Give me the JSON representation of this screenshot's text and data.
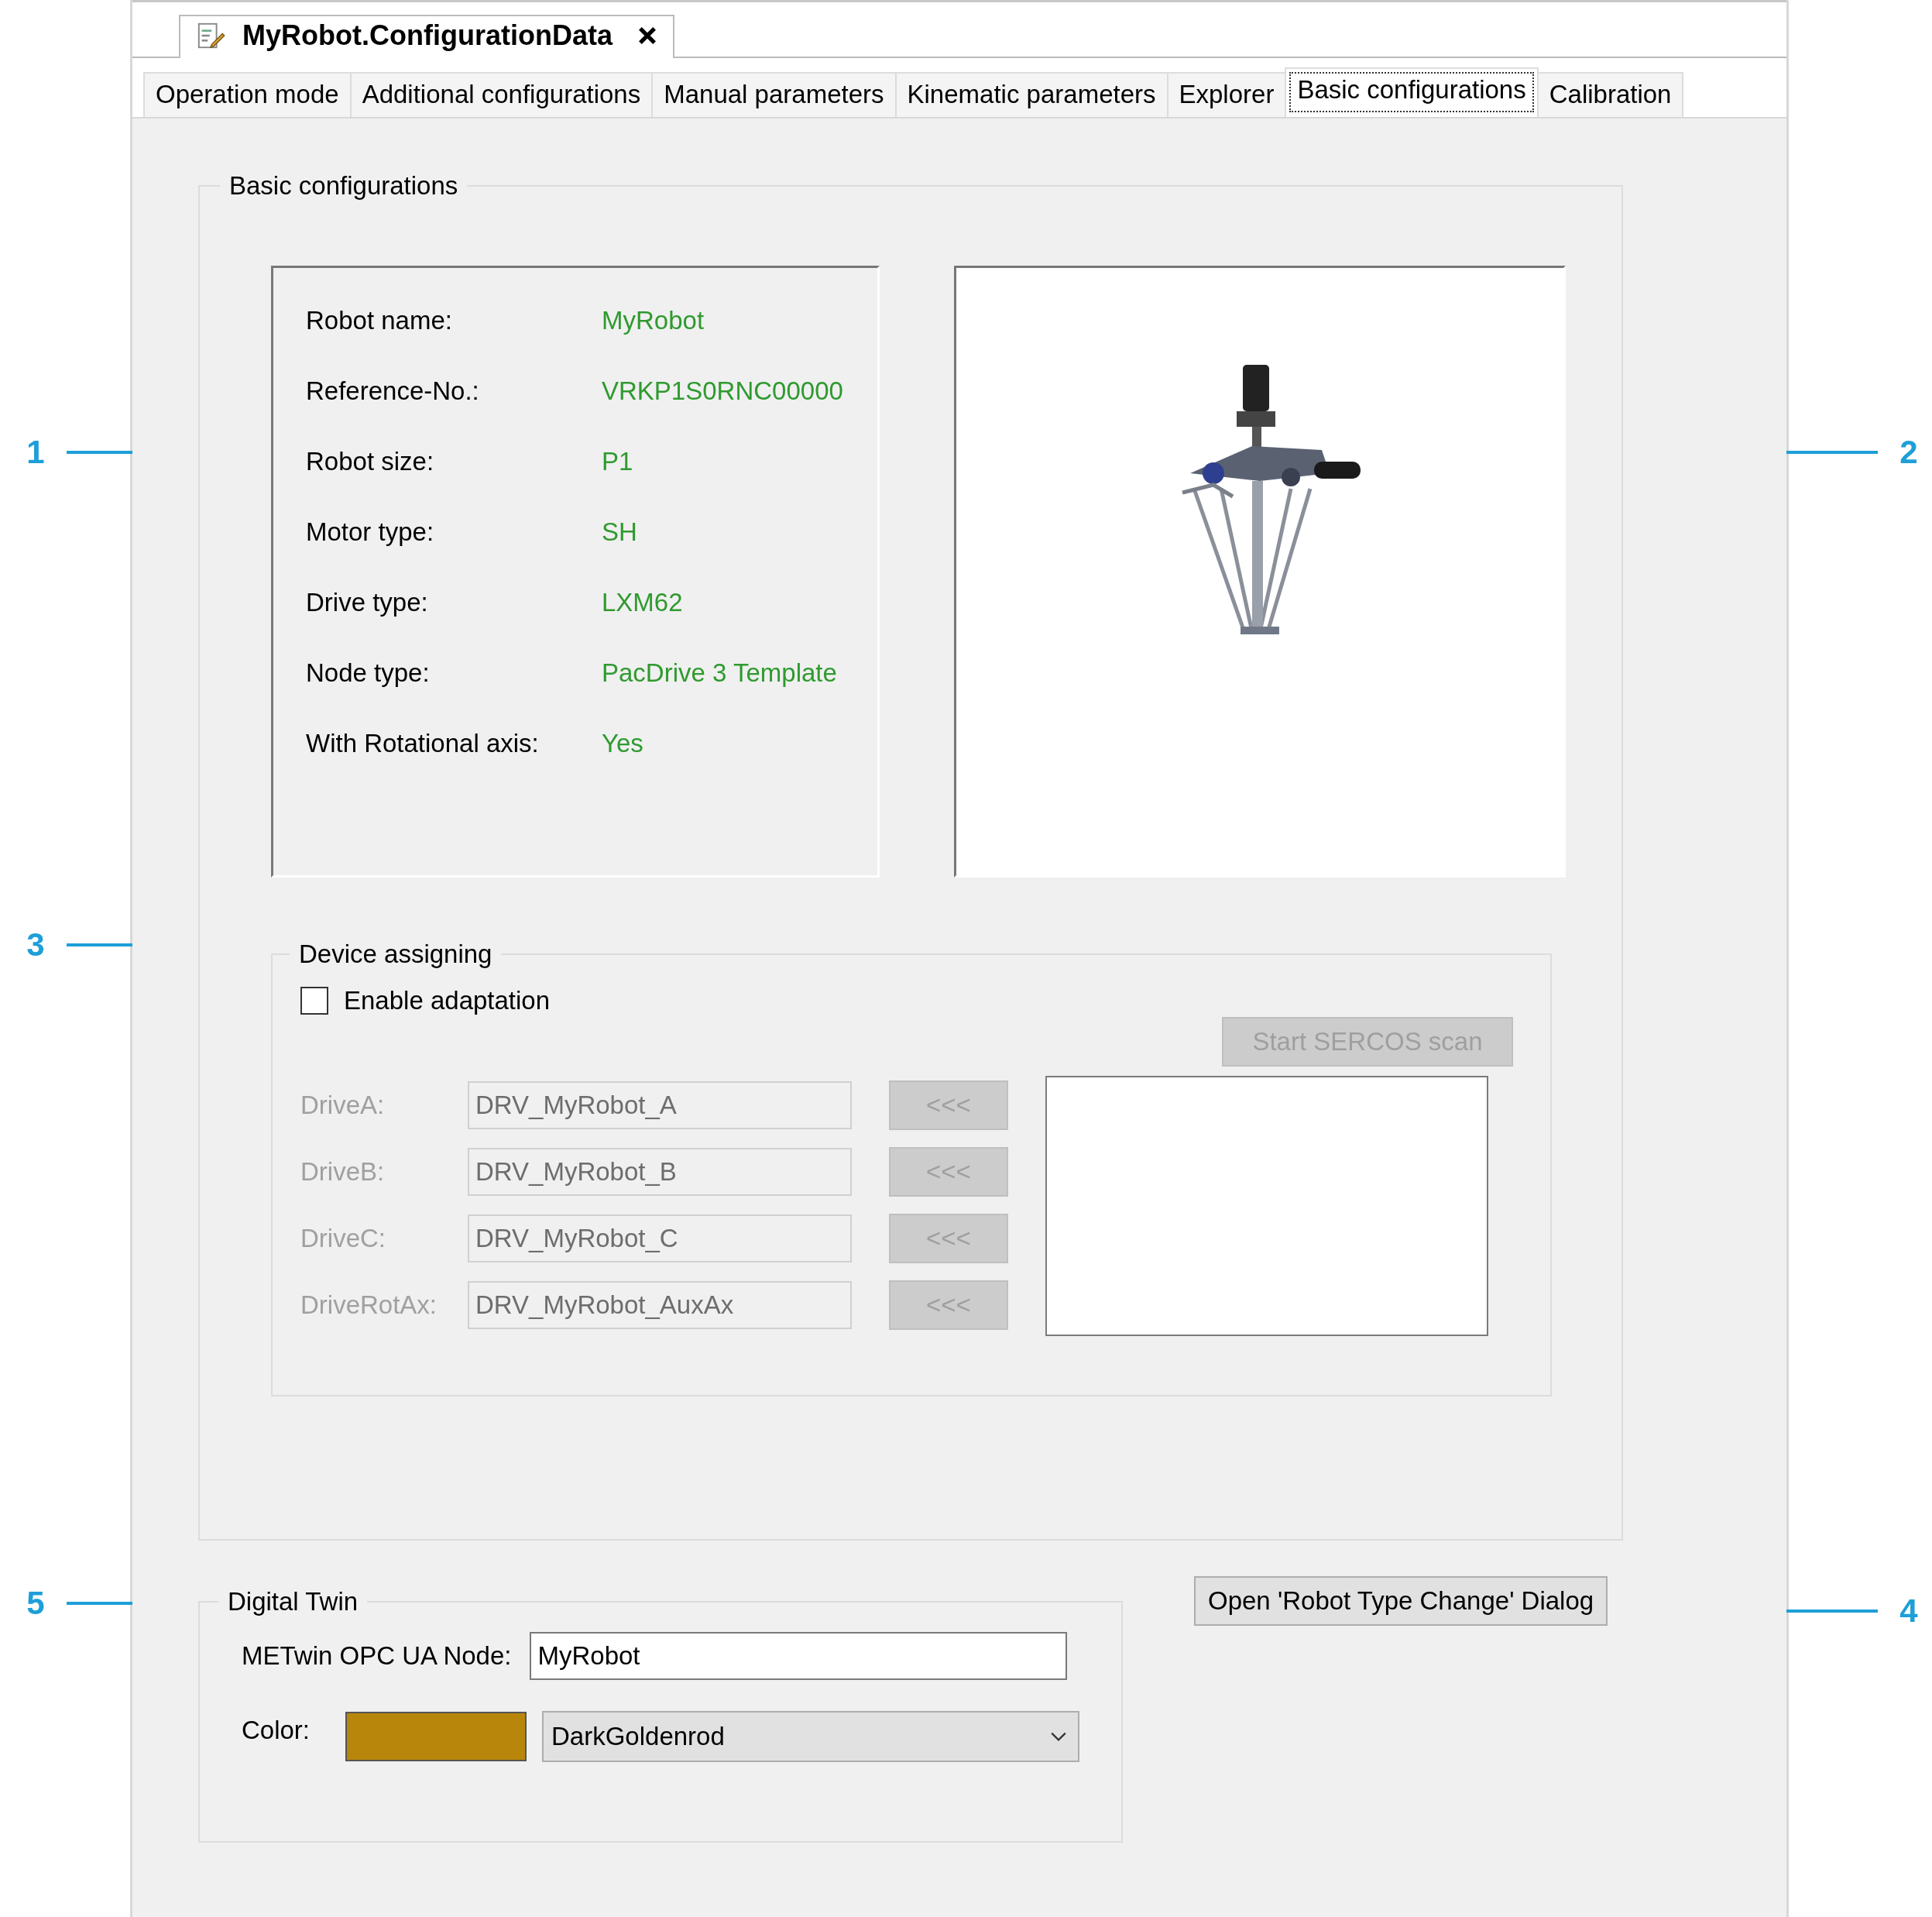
{
  "document_tab": {
    "title": "MyRobot.ConfigurationData"
  },
  "tabs": [
    {
      "label": "Operation mode",
      "selected": false
    },
    {
      "label": "Additional configurations",
      "selected": false
    },
    {
      "label": "Manual parameters",
      "selected": false
    },
    {
      "label": "Kinematic parameters",
      "selected": false
    },
    {
      "label": "Explorer",
      "selected": false
    },
    {
      "label": "Basic configurations",
      "selected": true
    },
    {
      "label": "Calibration",
      "selected": false
    }
  ],
  "basic_configurations": {
    "title": "Basic configurations",
    "properties": [
      {
        "label": "Robot name:",
        "value": "MyRobot"
      },
      {
        "label": "Reference-No.:",
        "value": "VRKP1S0RNC00000"
      },
      {
        "label": "Robot size:",
        "value": "P1"
      },
      {
        "label": "Motor type:",
        "value": "SH"
      },
      {
        "label": "Drive type:",
        "value": "LXM62"
      },
      {
        "label": "Node type:",
        "value": "PacDrive 3 Template"
      },
      {
        "label": "With Rotational axis:",
        "value": "Yes"
      }
    ]
  },
  "device_assigning": {
    "title": "Device assigning",
    "enable_adaptation": {
      "label": "Enable adaptation",
      "checked": false
    },
    "scan_button": {
      "label": "Start SERCOS scan",
      "disabled": true
    },
    "drives": [
      {
        "label": "DriveA:",
        "value": "DRV_MyRobot_A",
        "button": "<<<",
        "disabled": true
      },
      {
        "label": "DriveB:",
        "value": "DRV_MyRobot_B",
        "button": "<<<",
        "disabled": true
      },
      {
        "label": "DriveC:",
        "value": "DRV_MyRobot_C",
        "button": "<<<",
        "disabled": true
      },
      {
        "label": "DriveRotAx:",
        "value": "DRV_MyRobot_AuxAx",
        "button": "<<<",
        "disabled": true
      }
    ]
  },
  "digital_twin": {
    "title": "Digital Twin",
    "node_label": "METwin OPC UA Node:",
    "node_value": "MyRobot",
    "color_label": "Color:",
    "color": "#b8860b",
    "color_name": "DarkGoldenrod"
  },
  "open_dialog_button": {
    "label": "Open 'Robot Type Change' Dialog"
  },
  "callouts": [
    {
      "number": "1"
    },
    {
      "number": "2"
    },
    {
      "number": "3"
    },
    {
      "number": "5"
    },
    {
      "number": "4"
    }
  ]
}
